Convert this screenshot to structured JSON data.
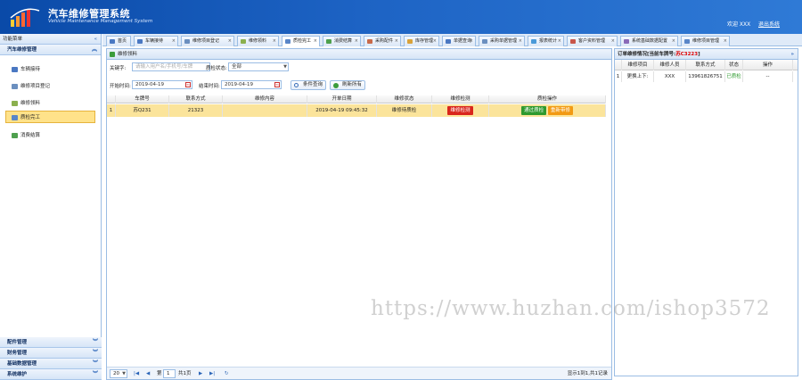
{
  "header": {
    "title": "汽车维修管理系统",
    "subtitle": "Vehicle Maintenance Management System",
    "welcome": "欢迎 XXX",
    "logout": "退出系统"
  },
  "sidebar": {
    "header": "功能菜单",
    "group_open": "汽车维修管理",
    "items": [
      {
        "label": "车辆接待",
        "icon": "car-icon"
      },
      {
        "label": "维修项目登记",
        "icon": "wrench-icon"
      },
      {
        "label": "维修领料",
        "icon": "parts-icon"
      },
      {
        "label": "质检完工",
        "icon": "check-icon"
      },
      {
        "label": "消费结算",
        "icon": "money-icon"
      }
    ],
    "groups_closed": [
      "配件管理",
      "财务管理",
      "基础数据管理",
      "系统维护"
    ]
  },
  "tabs": [
    "首页",
    "车辆接待",
    "维修项目登记",
    "维修领料",
    "质检完工",
    "消费结算",
    "采购配件",
    "库存管理",
    "单据查询",
    "采购单据管理",
    "报表统计",
    "客户资料管理",
    "系统基础数据配置",
    "维修项目管理"
  ],
  "active_tab": "质检完工",
  "panel": {
    "title": "维修领料",
    "keyword_label": "关键字:",
    "keyword_placeholder": "请输入用户名/手机号/车牌",
    "status_label": "质检状态:",
    "status_value": "全部",
    "start_label": "开始时间:",
    "start_value": "2019-04-19",
    "end_label": "结束时间:",
    "end_value": "2019-04-19",
    "search_button": "条件查询",
    "refresh_button": "刷新所有"
  },
  "grid": {
    "columns": [
      "车牌号",
      "联系方式",
      "维修内容",
      "开单日期",
      "维修状态",
      "维修检测",
      "质检操作"
    ],
    "rows": [
      {
        "index": "1",
        "plate": "苏Q231",
        "contact": "21323",
        "content": "",
        "date": "2019-04-19 09:45:32",
        "status": "维修待质检",
        "detect": "维修检测",
        "pass": "通过质检",
        "redo": "重新带修"
      }
    ]
  },
  "pager": {
    "page_size": "20",
    "page_prefix": "第",
    "page_value": "1",
    "page_suffix": "共1页",
    "summary": "显示1到1,共1记录"
  },
  "right_panel": {
    "title_prefix": "订单维修情况[当前车牌号:",
    "plate": "苏C3223",
    "title_suffix": "]",
    "columns": [
      "维修项目",
      "维修人员",
      "联系方式",
      "状态",
      "操作"
    ],
    "rows": [
      {
        "index": "1",
        "item": "更换上下:",
        "staff": "XXX",
        "phone": "13961826751",
        "status": "已质检",
        "op": "--"
      }
    ]
  },
  "watermark": "https://www.huzhan.com/ishop3572",
  "colors": {
    "header_blue": "#0a4aa8",
    "selected_row": "#fbe49b",
    "detect_red": "#d9261c",
    "pass_green": "#2e9a2e",
    "redo_orange": "#f29a13",
    "done_green": "#2e9a2e"
  }
}
